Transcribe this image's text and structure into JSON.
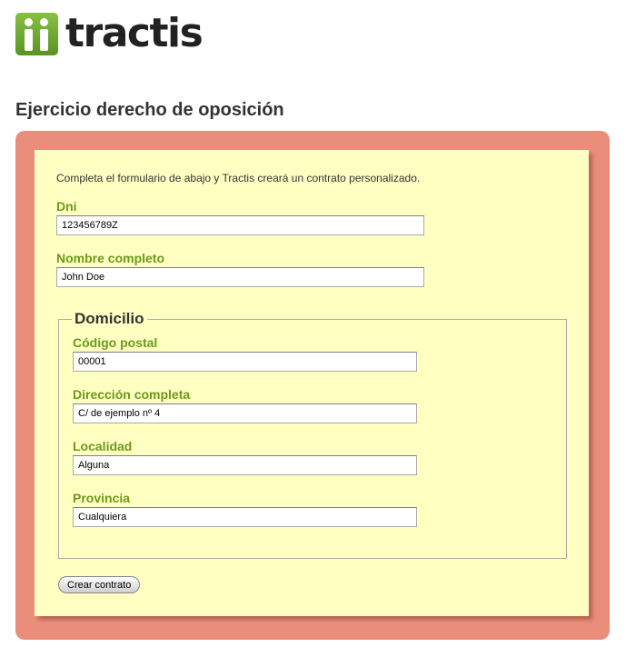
{
  "header": {
    "logo_text": "tractis",
    "logo_icon": "tractis-logo-icon"
  },
  "page": {
    "title": "Ejercicio derecho de oposición"
  },
  "form": {
    "intro": "Completa el formulario de abajo y Tractis creará un contrato personalizado.",
    "dni": {
      "label": "Dni",
      "value": "123456789Z"
    },
    "nombre": {
      "label": "Nombre completo",
      "value": "John Doe"
    },
    "domicilio": {
      "legend": "Domicilio",
      "codigo_postal": {
        "label": "Código postal",
        "value": "00001"
      },
      "direccion": {
        "label": "Dirección completa",
        "value": "C/ de ejemplo nº 4"
      },
      "localidad": {
        "label": "Localidad",
        "value": "Alguna"
      },
      "provincia": {
        "label": "Provincia",
        "value": "Cualquiera"
      }
    },
    "submit_label": "Crear contrato"
  },
  "colors": {
    "outer_box": "#ea8e7b",
    "inner_box": "#ffffc2",
    "label_green": "#6b9a1c",
    "logo_green": "#6aa52e"
  }
}
